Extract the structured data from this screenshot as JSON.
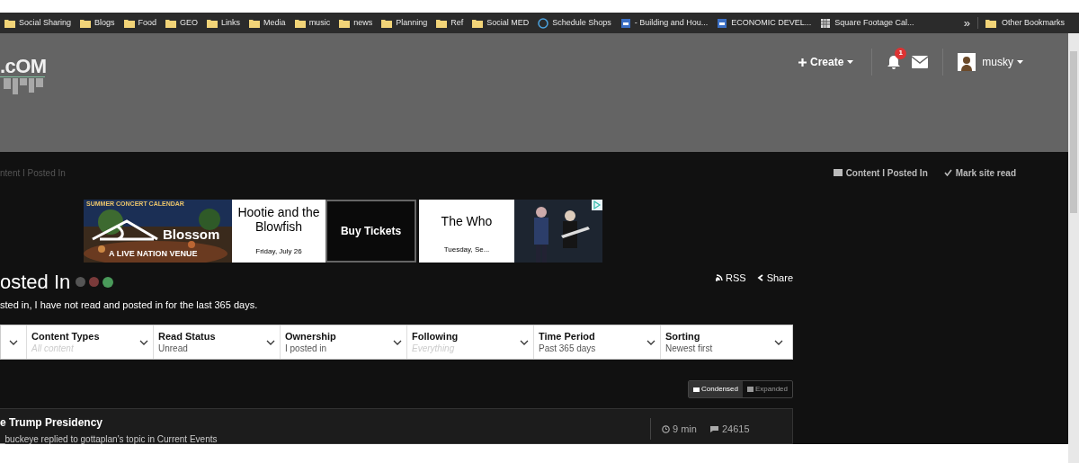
{
  "bookmarks": [
    {
      "label": "Social Sharing",
      "kind": "folder"
    },
    {
      "label": "Blogs",
      "kind": "folder"
    },
    {
      "label": "Food",
      "kind": "folder"
    },
    {
      "label": "GEO",
      "kind": "folder"
    },
    {
      "label": "Links",
      "kind": "folder"
    },
    {
      "label": "Media",
      "kind": "folder"
    },
    {
      "label": "music",
      "kind": "folder"
    },
    {
      "label": "news",
      "kind": "folder"
    },
    {
      "label": "Planning",
      "kind": "folder"
    },
    {
      "label": "Ref",
      "kind": "folder"
    },
    {
      "label": "Social MED",
      "kind": "folder"
    },
    {
      "label": "Schedule Shops",
      "kind": "globe"
    },
    {
      "label": "- Building and Hou...",
      "kind": "doc"
    },
    {
      "label": "ECONOMIC DEVEL...",
      "kind": "doc"
    },
    {
      "label": "Square Footage Cal...",
      "kind": "grid"
    }
  ],
  "bookmarks_more": "»",
  "other_bookmarks": "Other Bookmarks",
  "header": {
    "logo": ".cOM",
    "create": "Create",
    "notifications": "1",
    "user": "musky"
  },
  "breadcrumb": "ntent I Posted In",
  "page_actions": [
    "Content I Posted In",
    "Mark site read"
  ],
  "ad": {
    "heading": "SUMMER CONCERT CALENDAR",
    "venue": "Blossom",
    "venue_sub": "A LIVE NATION VENUE",
    "show1": "Hootie and the Blowfish",
    "date1": "Friday, July 26",
    "cta": "Buy Tickets",
    "show2": "The Who",
    "date2": "Tuesday, Se..."
  },
  "title": "osted In",
  "description": "sted in, I have not read and posted in for the last 365 days.",
  "feed_links": [
    "RSS",
    "Share"
  ],
  "filters": [
    {
      "label": "Content Types",
      "value": "All content",
      "placeholder": true
    },
    {
      "label": "Read Status",
      "value": "Unread",
      "placeholder": false
    },
    {
      "label": "Ownership",
      "value": "I posted in",
      "placeholder": false
    },
    {
      "label": "Following",
      "value": "Everything",
      "placeholder": true
    },
    {
      "label": "Time Period",
      "value": "Past 365 days",
      "placeholder": false
    },
    {
      "label": "Sorting",
      "value": "Newest first",
      "placeholder": false
    }
  ],
  "view_modes": [
    {
      "label": "Condensed",
      "selected": true
    },
    {
      "label": "Expanded",
      "selected": false
    }
  ],
  "topics": [
    {
      "title": "e Trump Presidency",
      "meta": "_buckeye replied to gottaplan's topic in Current Events",
      "time": "9 min",
      "replies": "24615"
    }
  ]
}
